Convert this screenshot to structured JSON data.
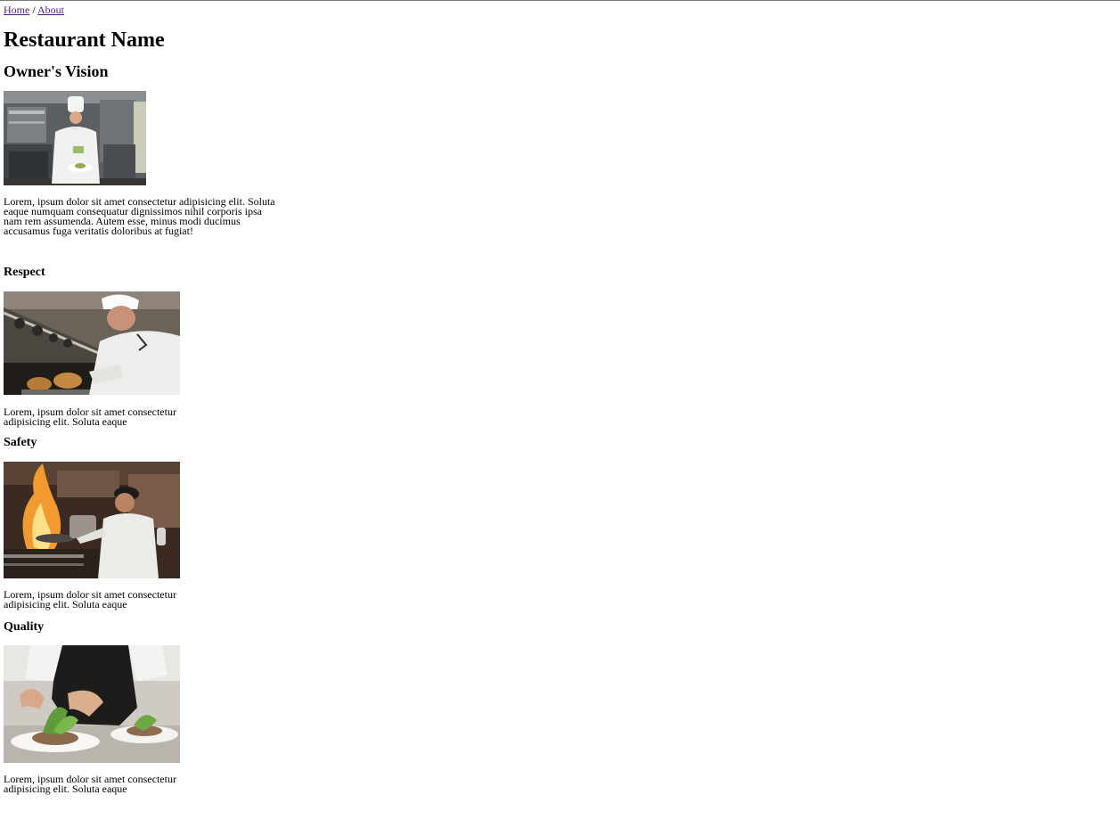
{
  "breadcrumb": {
    "home": "Home",
    "separator": " / ",
    "about": "About"
  },
  "site_title": "Restaurant Name",
  "vision": {
    "title": "Owner's Vision",
    "image": "photo of a chef in white uniform holding a plated dish in a kitchen",
    "text": "Lorem, ipsum dolor sit amet consectetur adipisicing elit. Soluta eaque numquam consequatur dignissimos nihil corporis ipsa nam rem assumenda. Autem esse, minus modi ducimus accusamus fuga veritatis doloribus at fugiat!"
  },
  "values": [
    {
      "title": "Respect",
      "image": "photo of a smiling chef taking baked bread out of an oven",
      "text": "Lorem, ipsum dolor sit amet consectetur adipisicing elit. Soluta eaque"
    },
    {
      "title": "Safety",
      "image": "photo of a chef cooking at a flaming stove",
      "text": "Lorem, ipsum dolor sit amet consectetur adipisicing elit. Soluta eaque"
    },
    {
      "title": "Quality",
      "image": "photo of hands garnishing plated dishes with greens",
      "text": "Lorem, ipsum dolor sit amet consectetur adipisicing elit. Soluta eaque"
    }
  ],
  "colors": {
    "link": "#551a8b",
    "text": "#000000",
    "background": "#ffffff"
  }
}
